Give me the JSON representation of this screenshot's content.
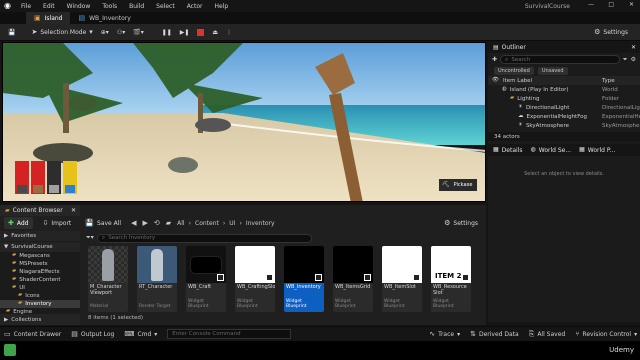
{
  "titlebar": {
    "menus": [
      "File",
      "Edit",
      "Window",
      "Tools",
      "Build",
      "Select",
      "Actor",
      "Help"
    ],
    "project": "SurvivalCourse"
  },
  "tabs": [
    {
      "label": "Island",
      "active": true
    },
    {
      "label": "WB_Inventory",
      "active": false
    }
  ],
  "toolbar": {
    "mode_label": "Selection Mode",
    "settings_label": "Settings"
  },
  "viewport": {
    "hotbar_slots": [
      "#d42323",
      "#d42323",
      "#2d2d2d",
      "#e6c21a"
    ],
    "tooltip": "Pickaxe"
  },
  "outliner": {
    "title": "Outliner",
    "search_placeholder": "Search",
    "filters": [
      "Uncontrolled",
      "Unsaved"
    ],
    "col_label": "Item Label",
    "col_type": "Type",
    "rows": [
      {
        "label": "Island (Play In Editor)",
        "type": "World",
        "indent": 0
      },
      {
        "label": "Lighting",
        "type": "Folder",
        "indent": 1
      },
      {
        "label": "DirectionalLight",
        "type": "DirectionalLig",
        "indent": 2
      },
      {
        "label": "ExponentialHeightFog",
        "type": "ExponentialHe",
        "indent": 2
      },
      {
        "label": "SkyAtmosphere",
        "type": "SkyAtmospher",
        "indent": 2
      }
    ],
    "count": "34 actors"
  },
  "details": {
    "tabs": [
      "Details",
      "World Se...",
      "World P..."
    ],
    "empty_message": "Select an object to view details."
  },
  "content_browser": {
    "title": "Content Browser",
    "add_label": "Add",
    "import_label": "Import",
    "save_all_label": "Save All",
    "path": [
      "All",
      "Content",
      "UI",
      "Inventory"
    ],
    "settings_label": "Settings",
    "search_placeholder": "Search Inventory",
    "favorites_label": "Favorites",
    "root_label": "SurvivalCourse",
    "folders": [
      {
        "label": "Megascans",
        "indent": 1
      },
      {
        "label": "MSPresets",
        "indent": 1
      },
      {
        "label": "NiagaraEffects",
        "indent": 1
      },
      {
        "label": "ShaderContent",
        "indent": 1
      },
      {
        "label": "UI",
        "indent": 1
      },
      {
        "label": "Icons",
        "indent": 2
      },
      {
        "label": "Inventory",
        "indent": 2
      },
      {
        "label": "Engine",
        "indent": 0
      }
    ],
    "collections_label": "Collections",
    "item_count": "8 items (1 selected)",
    "assets": [
      {
        "name": "M_Character Viewport",
        "kind": "Material",
        "selected": false
      },
      {
        "name": "RT_Character",
        "kind": "Render Target",
        "selected": false
      },
      {
        "name": "WB_Craft",
        "kind": "Widget Blueprint",
        "selected": false
      },
      {
        "name": "WB_CraftingSlot",
        "kind": "Widget Blueprint",
        "selected": false
      },
      {
        "name": "WB_Inventory",
        "kind": "Widget Blueprint",
        "selected": true
      },
      {
        "name": "WB_ItemsGrid",
        "kind": "Widget Blueprint",
        "selected": false
      },
      {
        "name": "WB_ItemSlot",
        "kind": "Widget Blueprint",
        "selected": false
      },
      {
        "name": "WB_Resource Slot",
        "kind": "Widget Blueprint",
        "selected": false
      }
    ],
    "item2_label": "ITEM 2"
  },
  "statusbar": {
    "content_drawer": "Content Drawer",
    "output_log": "Output Log",
    "cmd": "Cmd",
    "console_placeholder": "Enter Console Command",
    "trace": "Trace",
    "derived_data": "Derived Data",
    "all_saved": "All Saved",
    "revision_control": "Revision Control"
  },
  "udemy": "Udemy"
}
